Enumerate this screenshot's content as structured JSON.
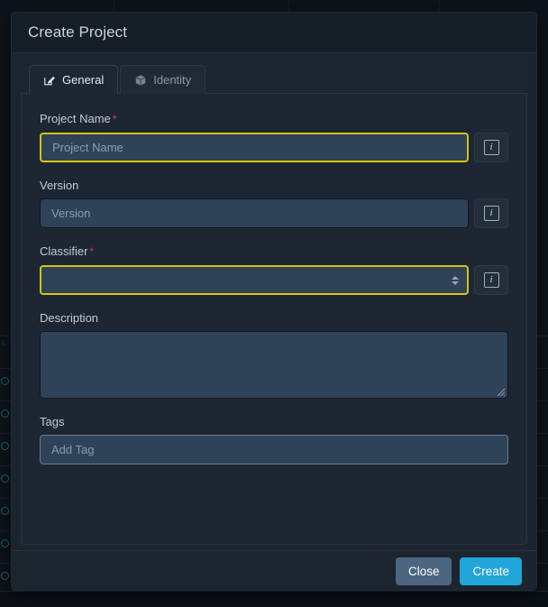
{
  "modal": {
    "title": "Create Project",
    "tabs": [
      {
        "label": "General",
        "icon": "edit-square-icon",
        "active": true
      },
      {
        "label": "Identity",
        "icon": "cube-icon",
        "active": false
      }
    ],
    "fields": {
      "project_name": {
        "label": "Project Name",
        "required": true,
        "required_marker": "*",
        "value": "",
        "placeholder": "Project Name",
        "invalid": true,
        "info_button": {
          "icon": "info-icon",
          "glyph": "i"
        }
      },
      "version": {
        "label": "Version",
        "required": false,
        "value": "",
        "placeholder": "Version",
        "invalid": false,
        "info_button": {
          "icon": "info-icon",
          "glyph": "i"
        }
      },
      "classifier": {
        "label": "Classifier",
        "required": true,
        "required_marker": "*",
        "value": "",
        "selected_option": "",
        "invalid": true,
        "caret_icon": "updown-caret-icon",
        "info_button": {
          "icon": "info-icon",
          "glyph": "i"
        }
      },
      "description": {
        "label": "Description",
        "required": false,
        "value": "",
        "placeholder": "",
        "resize_handle": "resize-grip-icon"
      },
      "tags": {
        "label": "Tags",
        "required": false,
        "value": "",
        "placeholder": "Add Tag"
      }
    },
    "footer": {
      "close_label": "Close",
      "create_label": "Create"
    }
  },
  "colors": {
    "modal_bg": "#1b242f",
    "header_bg": "#161e28",
    "panel_bg": "#1d2733",
    "input_bg": "#2e4258",
    "invalid_border": "#d6c412",
    "required_asterisk": "#dc3545",
    "create_button": "#22a5d8",
    "close_button": "#4c6681",
    "backdrop": "#0e141b"
  }
}
